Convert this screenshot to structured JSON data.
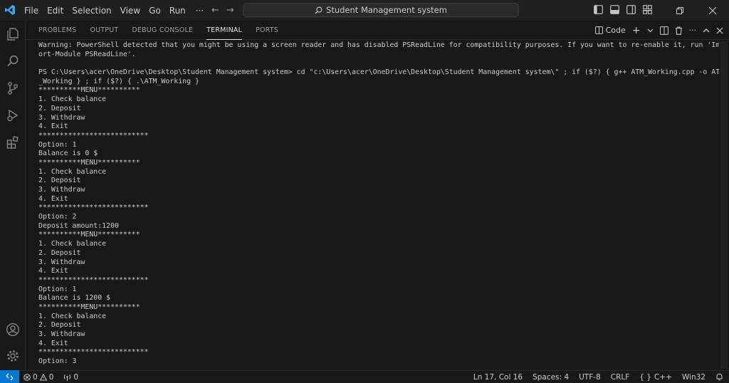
{
  "titlebar": {
    "menu": [
      "File",
      "Edit",
      "Selection",
      "View",
      "Go",
      "Run"
    ],
    "more": "···",
    "search_text": "Student Management system",
    "back": "←",
    "forward": "→"
  },
  "panel": {
    "tabs": [
      "PROBLEMS",
      "OUTPUT",
      "DEBUG CONSOLE",
      "TERMINAL",
      "PORTS"
    ],
    "active_tab": "TERMINAL",
    "terminal_name": "Code",
    "add": "+",
    "more": "···",
    "maximize": "∧",
    "close": "✕"
  },
  "terminal": {
    "lines": [
      "Warning: PowerShell detected that you might be using a screen reader and has disabled PSReadLine for compatibility purposes. If you want to re-enable it, run 'Imp",
      "ort-Module PSReadLine'.",
      "",
      "PS C:\\Users\\acer\\OneDrive\\Desktop\\Student Management system> cd \"c:\\Users\\acer\\OneDrive\\Desktop\\Student Management system\\\" ; if ($?) { g++ ATM_Working.cpp -o ATM",
      "_Working } ; if ($?) { .\\ATM_Working }",
      "**********MENU**********",
      "1. Check balance",
      "2. Deposit",
      "3. Withdraw",
      "4. Exit",
      "**************************",
      "Option: 1",
      "Balance is 0 $",
      "**********MENU**********",
      "1. Check balance",
      "2. Deposit",
      "3. Withdraw",
      "4. Exit",
      "**************************",
      "Option: 2",
      "Deposit amount:1200",
      "**********MENU**********",
      "1. Check balance",
      "2. Deposit",
      "3. Withdraw",
      "4. Exit",
      "**************************",
      "Option: 1",
      "Balance is 1200 $",
      "**********MENU**********",
      "1. Check balance",
      "2. Deposit",
      "3. Withdraw",
      "4. Exit",
      "**************************",
      "Option: 3"
    ]
  },
  "statusbar": {
    "remote": "⨯",
    "errors": "0",
    "warnings": "0",
    "ports": "0",
    "position": "Ln 17, Col 16",
    "spaces": "Spaces: 4",
    "encoding": "UTF-8",
    "eol": "CRLF",
    "language": "C++",
    "platform": "Win32"
  },
  "colors": {
    "accent": "#0078d4",
    "background": "#1f1f1f",
    "panel": "#181818",
    "text": "#cccccc"
  }
}
